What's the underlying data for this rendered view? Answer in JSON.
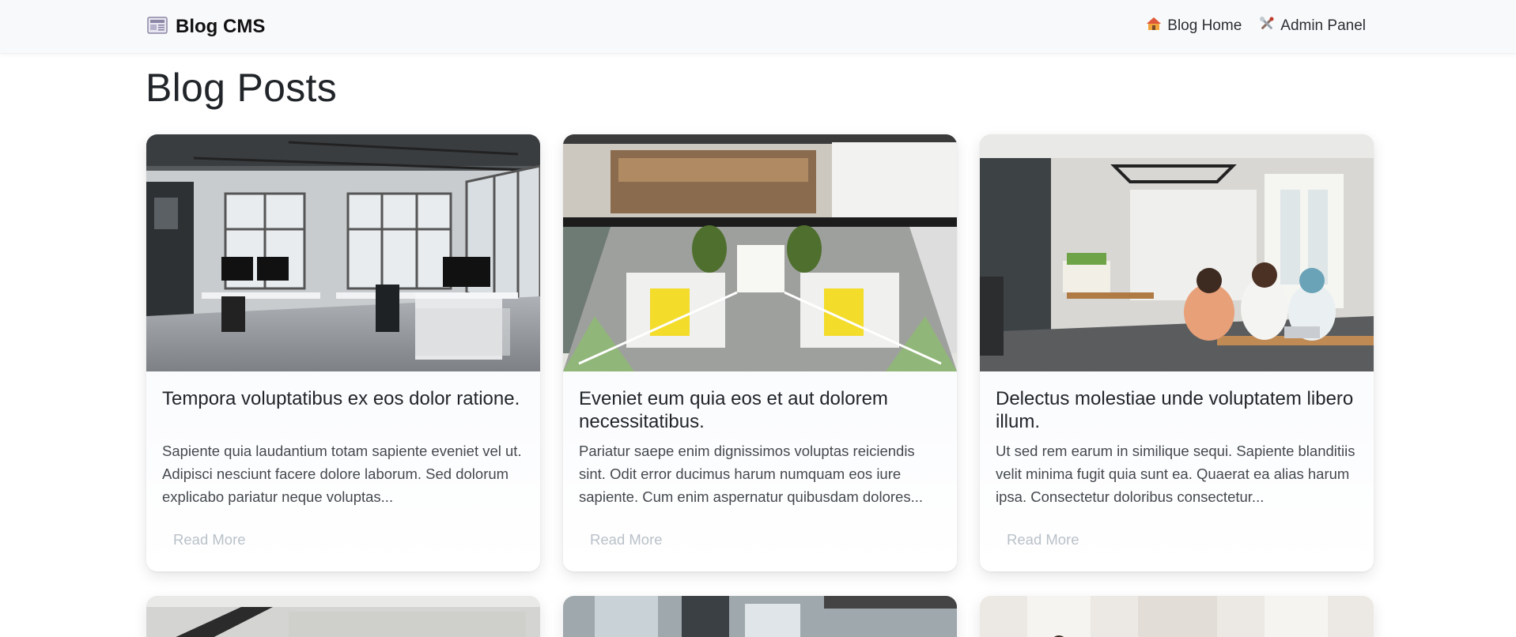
{
  "navbar": {
    "brand": "Blog CMS",
    "brand_icon": "newspaper-icon",
    "links": [
      {
        "label": "Blog Home",
        "icon": "house-icon"
      },
      {
        "label": "Admin Panel",
        "icon": "tools-icon"
      }
    ]
  },
  "page": {
    "title": "Blog Posts"
  },
  "posts": [
    {
      "title": "Tempora voluptatibus ex eos dolor ratione.",
      "excerpt": "Sapiente quia laudantium totam sapiente eveniet vel ut. Adipisci nesciunt facere dolore laborum. Sed dolorum explicabo pariatur neque voluptas...",
      "read_more": "Read More",
      "image": "office-interior-photo"
    },
    {
      "title": "Eveniet eum quia eos et aut dolorem necessitatibus.",
      "excerpt": "Pariatur saepe enim dignissimos voluptas reiciendis sint. Odit error ducimus harum numquam eos iure sapiente. Cum enim aspernatur quibusdam dolores...",
      "read_more": "Read More",
      "image": "open-office-photo"
    },
    {
      "title": "Delectus molestiae unde voluptatem libero illum.",
      "excerpt": "Ut sed rem earum in similique sequi. Sapiente blanditiis velit minima fugit quia sunt ea. Quaerat ea alias harum ipsa. Consectetur doloribus consectetur...",
      "read_more": "Read More",
      "image": "team-meeting-photo"
    }
  ],
  "colors": {
    "navbar_bg": "#f8f9fa",
    "read_more": "#b9c1c8",
    "text": "#212529"
  }
}
